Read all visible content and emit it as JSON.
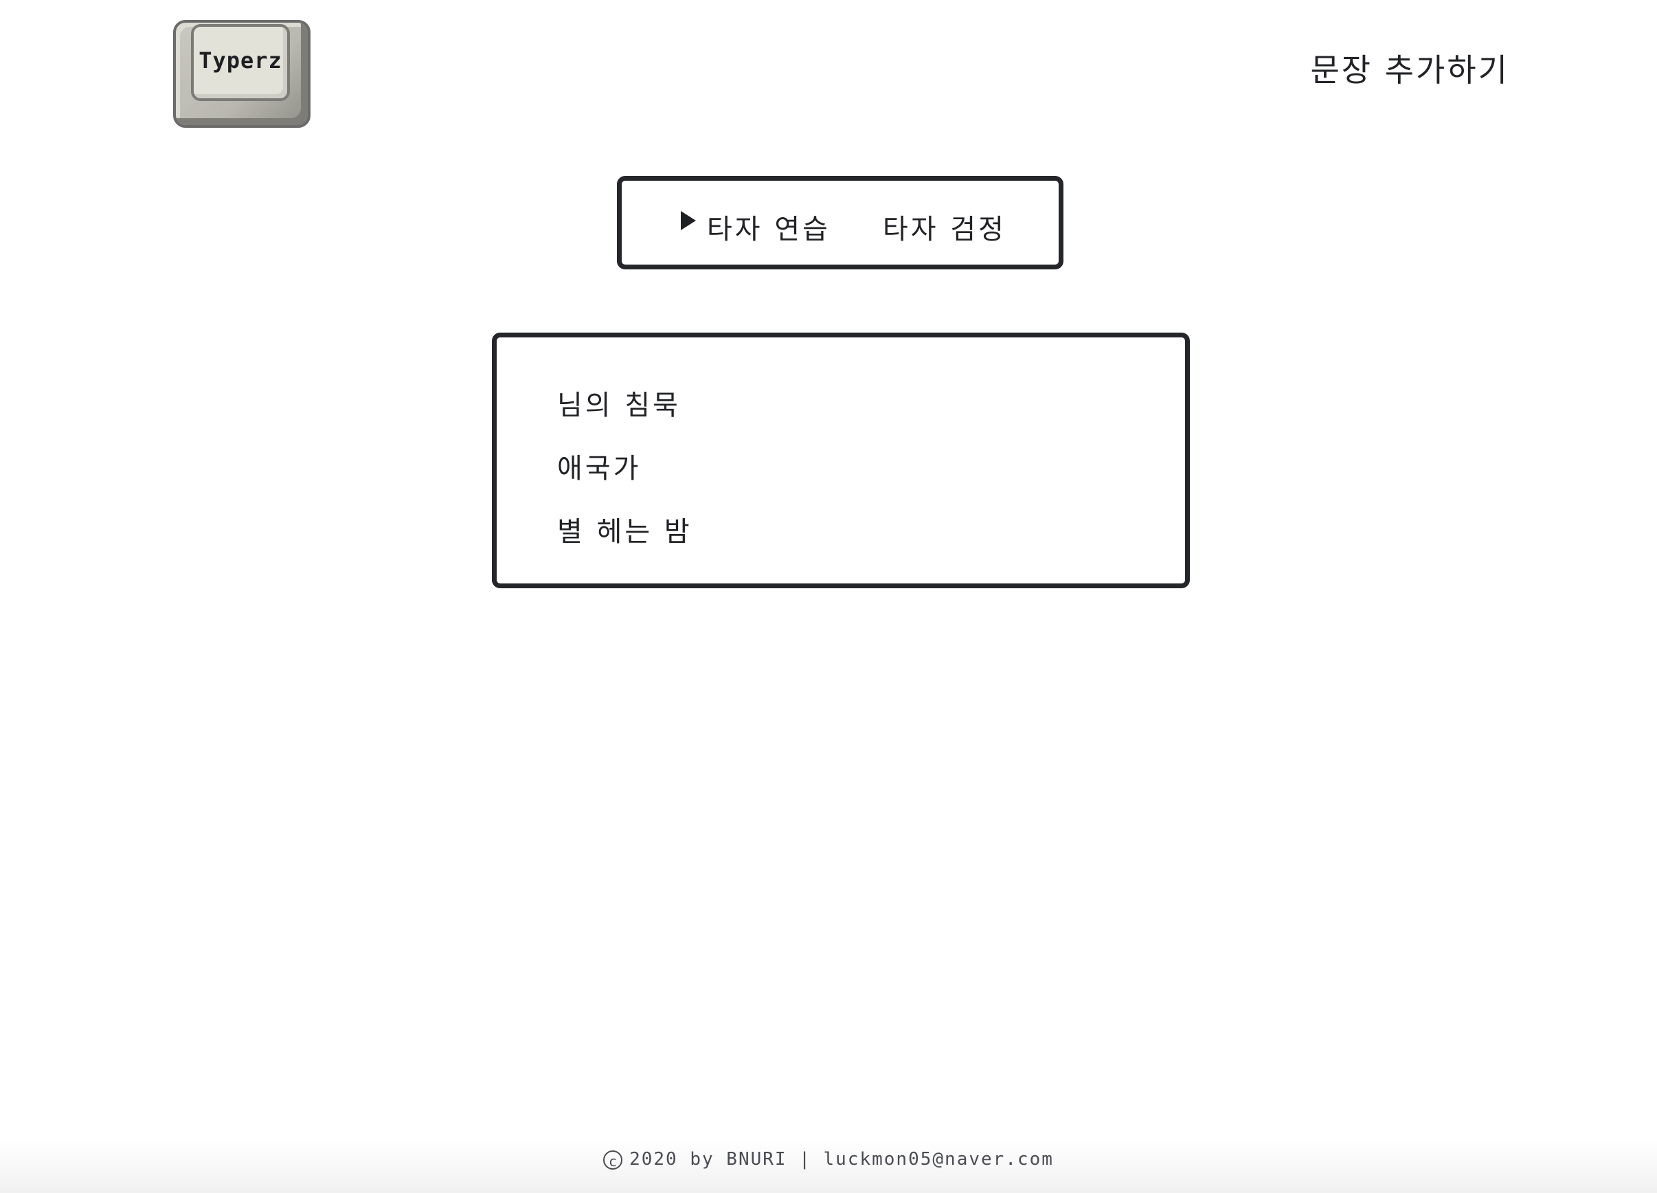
{
  "header": {
    "logo_text": "Typerz",
    "add_sentence_label": "문장 추가하기"
  },
  "mode_menu": {
    "items": [
      {
        "label": "타자 연습",
        "selected": true
      },
      {
        "label": "타자 검정",
        "selected": false
      }
    ],
    "selector_icon": "triangle-pointer-icon"
  },
  "text_list": {
    "items": [
      {
        "title": "님의 침묵"
      },
      {
        "title": "애국가"
      },
      {
        "title": "별 헤는 밤"
      }
    ]
  },
  "footer": {
    "copyright_symbol": "c",
    "text": "2020 by BNURI | luckmon05@naver.com"
  },
  "colors": {
    "text": "#222326",
    "border": "#24262a",
    "background": "#ffffff",
    "footer_text": "#4a4c52"
  }
}
